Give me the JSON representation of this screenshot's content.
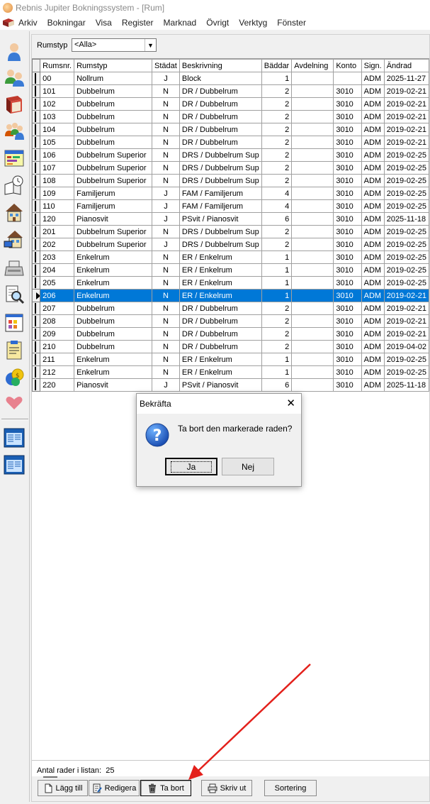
{
  "window": {
    "title": "Rebnis Jupiter Bokningssystem - [Rum]"
  },
  "menu": {
    "items": [
      "Arkiv",
      "Bokningar",
      "Visa",
      "Register",
      "Marknad",
      "Övrigt",
      "Verktyg",
      "Fönster"
    ]
  },
  "sidebar": {
    "icons": [
      "person-icon",
      "people-icon",
      "book-icon",
      "group-icon",
      "calendar-icon",
      "clock-book-icon",
      "house-icon",
      "house-card-icon",
      "cash-register-icon",
      "search-document-icon",
      "color-chart-icon",
      "clipboard-icon",
      "money-icon",
      "heart-icon",
      "window-icon",
      "window-icon"
    ]
  },
  "filter": {
    "label": "Rumstyp",
    "value": "<Alla>"
  },
  "grid": {
    "columns": [
      "Rumsnr.",
      "Rumstyp",
      "Städat",
      "Beskrivning",
      "Bäddar",
      "Avdelning",
      "Konto",
      "Sign.",
      "Ändrad"
    ],
    "selected_index": 17,
    "rows": [
      {
        "rumsnr": "00",
        "rumstyp": "Nollrum",
        "stadat": "J",
        "beskrivning": "Block",
        "baddar": "1",
        "avdelning": "",
        "konto": "",
        "sign": "ADM",
        "andrad": "2025-11-27"
      },
      {
        "rumsnr": "101",
        "rumstyp": "Dubbelrum",
        "stadat": "N",
        "beskrivning": "DR / Dubbelrum",
        "baddar": "2",
        "avdelning": "",
        "konto": "3010",
        "sign": "ADM",
        "andrad": "2019-02-21"
      },
      {
        "rumsnr": "102",
        "rumstyp": "Dubbelrum",
        "stadat": "N",
        "beskrivning": "DR / Dubbelrum",
        "baddar": "2",
        "avdelning": "",
        "konto": "3010",
        "sign": "ADM",
        "andrad": "2019-02-21"
      },
      {
        "rumsnr": "103",
        "rumstyp": "Dubbelrum",
        "stadat": "N",
        "beskrivning": "DR / Dubbelrum",
        "baddar": "2",
        "avdelning": "",
        "konto": "3010",
        "sign": "ADM",
        "andrad": "2019-02-21"
      },
      {
        "rumsnr": "104",
        "rumstyp": "Dubbelrum",
        "stadat": "N",
        "beskrivning": "DR / Dubbelrum",
        "baddar": "2",
        "avdelning": "",
        "konto": "3010",
        "sign": "ADM",
        "andrad": "2019-02-21"
      },
      {
        "rumsnr": "105",
        "rumstyp": "Dubbelrum",
        "stadat": "N",
        "beskrivning": "DR / Dubbelrum",
        "baddar": "2",
        "avdelning": "",
        "konto": "3010",
        "sign": "ADM",
        "andrad": "2019-02-21"
      },
      {
        "rumsnr": "106",
        "rumstyp": "Dubbelrum Superior",
        "stadat": "N",
        "beskrivning": "DRS / Dubbelrum Sup",
        "baddar": "2",
        "avdelning": "",
        "konto": "3010",
        "sign": "ADM",
        "andrad": "2019-02-25"
      },
      {
        "rumsnr": "107",
        "rumstyp": "Dubbelrum Superior",
        "stadat": "N",
        "beskrivning": "DRS / Dubbelrum Sup",
        "baddar": "2",
        "avdelning": "",
        "konto": "3010",
        "sign": "ADM",
        "andrad": "2019-02-25"
      },
      {
        "rumsnr": "108",
        "rumstyp": "Dubbelrum Superior",
        "stadat": "N",
        "beskrivning": "DRS / Dubbelrum Sup",
        "baddar": "2",
        "avdelning": "",
        "konto": "3010",
        "sign": "ADM",
        "andrad": "2019-02-25"
      },
      {
        "rumsnr": "109",
        "rumstyp": "Familjerum",
        "stadat": "J",
        "beskrivning": "FAM / Familjerum",
        "baddar": "4",
        "avdelning": "",
        "konto": "3010",
        "sign": "ADM",
        "andrad": "2019-02-25"
      },
      {
        "rumsnr": "110",
        "rumstyp": "Familjerum",
        "stadat": "J",
        "beskrivning": "FAM / Familjerum",
        "baddar": "4",
        "avdelning": "",
        "konto": "3010",
        "sign": "ADM",
        "andrad": "2019-02-25"
      },
      {
        "rumsnr": "120",
        "rumstyp": "Pianosvit",
        "stadat": "J",
        "beskrivning": "PSvit / Pianosvit",
        "baddar": "6",
        "avdelning": "",
        "konto": "3010",
        "sign": "ADM",
        "andrad": "2025-11-18"
      },
      {
        "rumsnr": "201",
        "rumstyp": "Dubbelrum Superior",
        "stadat": "N",
        "beskrivning": "DRS / Dubbelrum Sup",
        "baddar": "2",
        "avdelning": "",
        "konto": "3010",
        "sign": "ADM",
        "andrad": "2019-02-25"
      },
      {
        "rumsnr": "202",
        "rumstyp": "Dubbelrum Superior",
        "stadat": "J",
        "beskrivning": "DRS / Dubbelrum Sup",
        "baddar": "2",
        "avdelning": "",
        "konto": "3010",
        "sign": "ADM",
        "andrad": "2019-02-25"
      },
      {
        "rumsnr": "203",
        "rumstyp": "Enkelrum",
        "stadat": "N",
        "beskrivning": "ER / Enkelrum",
        "baddar": "1",
        "avdelning": "",
        "konto": "3010",
        "sign": "ADM",
        "andrad": "2019-02-25"
      },
      {
        "rumsnr": "204",
        "rumstyp": "Enkelrum",
        "stadat": "N",
        "beskrivning": "ER / Enkelrum",
        "baddar": "1",
        "avdelning": "",
        "konto": "3010",
        "sign": "ADM",
        "andrad": "2019-02-25"
      },
      {
        "rumsnr": "205",
        "rumstyp": "Enkelrum",
        "stadat": "N",
        "beskrivning": "ER / Enkelrum",
        "baddar": "1",
        "avdelning": "",
        "konto": "3010",
        "sign": "ADM",
        "andrad": "2019-02-25"
      },
      {
        "rumsnr": "206",
        "rumstyp": "Enkelrum",
        "stadat": "N",
        "beskrivning": "ER / Enkelrum",
        "baddar": "1",
        "avdelning": "",
        "konto": "3010",
        "sign": "ADM",
        "andrad": "2019-02-21"
      },
      {
        "rumsnr": "207",
        "rumstyp": "Dubbelrum",
        "stadat": "N",
        "beskrivning": "DR / Dubbelrum",
        "baddar": "2",
        "avdelning": "",
        "konto": "3010",
        "sign": "ADM",
        "andrad": "2019-02-21"
      },
      {
        "rumsnr": "208",
        "rumstyp": "Dubbelrum",
        "stadat": "N",
        "beskrivning": "DR / Dubbelrum",
        "baddar": "2",
        "avdelning": "",
        "konto": "3010",
        "sign": "ADM",
        "andrad": "2019-02-21"
      },
      {
        "rumsnr": "209",
        "rumstyp": "Dubbelrum",
        "stadat": "N",
        "beskrivning": "DR / Dubbelrum",
        "baddar": "2",
        "avdelning": "",
        "konto": "3010",
        "sign": "ADM",
        "andrad": "2019-02-21"
      },
      {
        "rumsnr": "210",
        "rumstyp": "Dubbelrum",
        "stadat": "N",
        "beskrivning": "DR / Dubbelrum",
        "baddar": "2",
        "avdelning": "",
        "konto": "3010",
        "sign": "ADM",
        "andrad": "2019-04-02"
      },
      {
        "rumsnr": "211",
        "rumstyp": "Enkelrum",
        "stadat": "N",
        "beskrivning": "ER / Enkelrum",
        "baddar": "1",
        "avdelning": "",
        "konto": "3010",
        "sign": "ADM",
        "andrad": "2019-02-25"
      },
      {
        "rumsnr": "212",
        "rumstyp": "Enkelrum",
        "stadat": "N",
        "beskrivning": "ER / Enkelrum",
        "baddar": "1",
        "avdelning": "",
        "konto": "3010",
        "sign": "ADM",
        "andrad": "2019-02-25"
      },
      {
        "rumsnr": "220",
        "rumstyp": "Pianosvit",
        "stadat": "J",
        "beskrivning": "PSvit / Pianosvit",
        "baddar": "6",
        "avdelning": "",
        "konto": "3010",
        "sign": "ADM",
        "andrad": "2025-11-18"
      }
    ]
  },
  "status": {
    "count_label": "Antal rader i listan:",
    "count_value": "25"
  },
  "toolbar": {
    "add_label": "Lägg till",
    "edit_label": "Redigera",
    "delete_label": "Ta bort",
    "print_label": "Skriv ut",
    "sort_label": "Sortering"
  },
  "dialog": {
    "title": "Bekräfta",
    "message": "Ta bort den markerade raden?",
    "yes_label": "Ja",
    "no_label": "Nej"
  },
  "colors": {
    "selection": "#0078d7",
    "annotation_arrow": "#e3201b"
  }
}
